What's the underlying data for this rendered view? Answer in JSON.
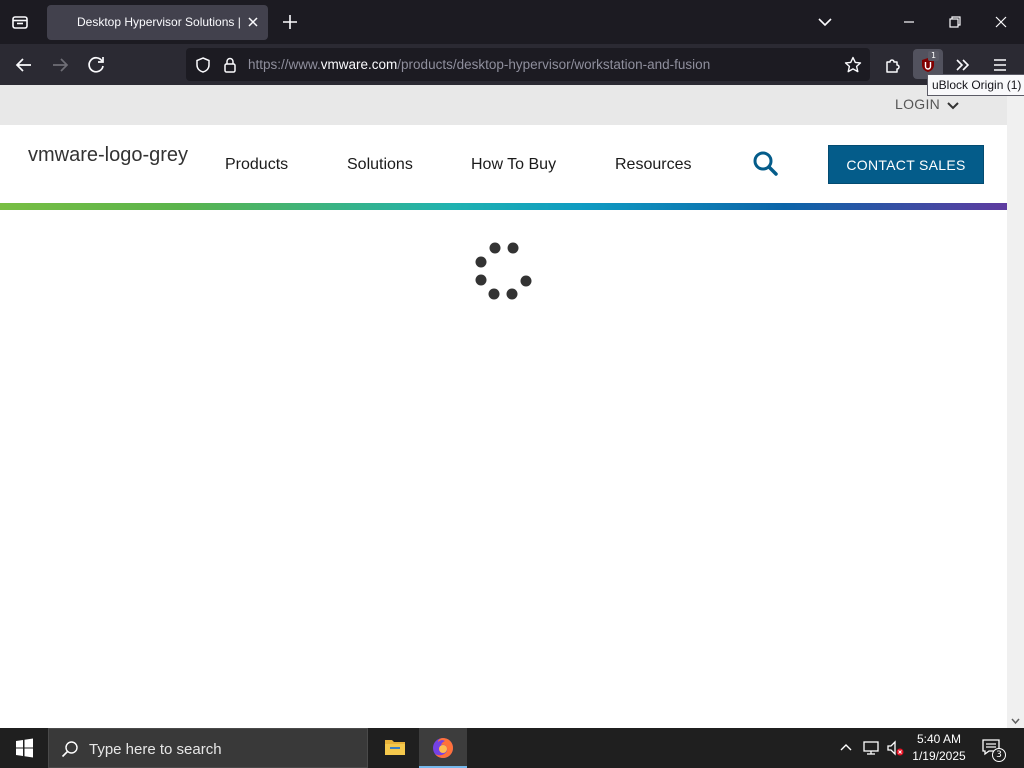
{
  "browser": {
    "tab": {
      "title": "Desktop Hypervisor Solutions | VMware"
    },
    "url": {
      "prefix": "https://www.",
      "host": "vmware.com",
      "path": "/products/desktop-hypervisor/workstation-and-fusion"
    },
    "extension": {
      "badge": "1",
      "tooltip": "uBlock Origin (1)"
    }
  },
  "page": {
    "login_label": "LOGIN",
    "logo_alt": "vmware-logo-grey",
    "menu": [
      "Products",
      "Solutions",
      "How To Buy",
      "Resources"
    ],
    "contact_label": "CONTACT SALES"
  },
  "taskbar": {
    "search_placeholder": "Type here to search",
    "time": "5:40 AM",
    "date": "1/19/2025",
    "notification_count": "3"
  },
  "colors": {
    "chrome_dark": "#1c1b22",
    "toolbar": "#2b2a33",
    "vmware_blue": "#045c8a",
    "accent_green": "#78be43",
    "accent_purple": "#5e3ba0"
  }
}
